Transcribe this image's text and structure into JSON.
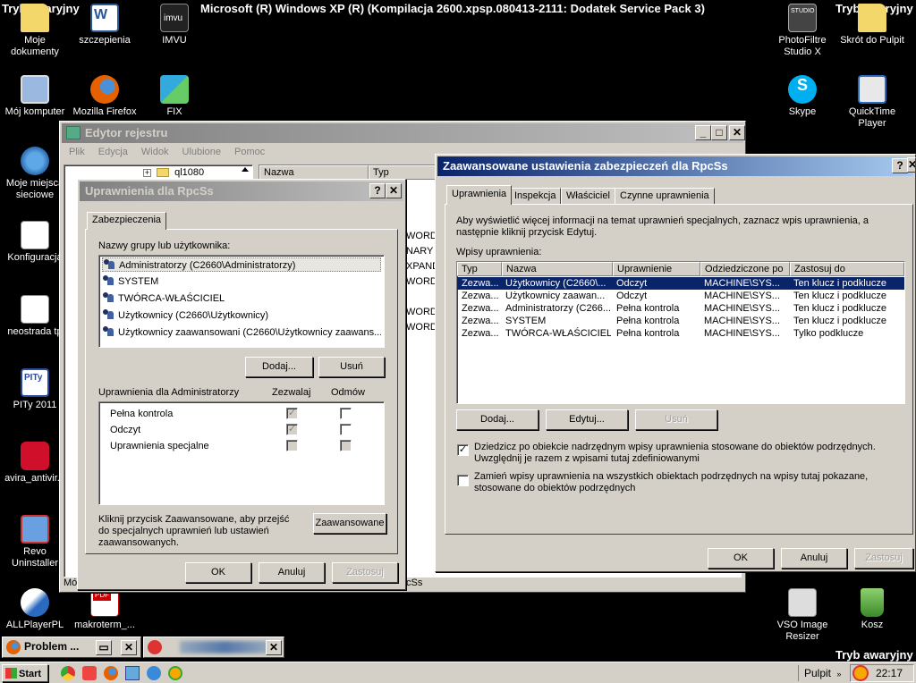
{
  "desktop": {
    "header_left": "Tryb awaryjny",
    "header_title": "Microsoft (R) Windows XP (R) (Kompilacja 2600.xpsp.080413-2111: Dodatek Service Pack 3)",
    "header_right": "Tryb awaryjny",
    "footer_right": "Tryb awaryjny",
    "icons": {
      "moje_dokumenty": "Moje dokumenty",
      "szczepienia": "szczepienia",
      "imvu": "IMVU",
      "moj_komputer": "Mój komputer",
      "firefox": "Mozilla Firefox",
      "fix": "FIX",
      "miejsca": "Moje miejsca sieciowe",
      "konfiguracja": "Konfiguracja",
      "neostrada": "neostrada tp",
      "pity": "PITy 2011",
      "avira": "avira_antivir...",
      "revo": "Revo Uninstaller",
      "allplayer": "ALLPlayerPL",
      "makroterm": "makroterm_...",
      "photofiltre": "PhotoFiltre Studio X",
      "skrot": "Skrót do Pulpit",
      "skype": "Skype",
      "quicktime": "QuickTime Player",
      "vso": "VSO Image Resizer",
      "kosz": "Kosz"
    }
  },
  "regedit": {
    "title": "Edytor rejestru",
    "menu": [
      "Plik",
      "Edycja",
      "Widok",
      "Ulubione",
      "Pomoc"
    ],
    "tree_item": "ql1080",
    "col_name": "Nazwa",
    "col_type": "Typ",
    "type_values": [
      "WORD",
      "NARY",
      "XPAND_",
      "WORD",
      "WORD",
      "WORD"
    ],
    "status_left": "Mó",
    "status_right": "ìcSs"
  },
  "perm_dialog": {
    "title": "Uprawnienia dla RpcSs",
    "help": "?",
    "close": "✕",
    "tab": "Zabezpieczenia",
    "group_label": "Nazwy grupy lub użytkownika:",
    "users": [
      "Administratorzy (C2660\\Administratorzy)",
      "SYSTEM",
      "TWÓRCA-WŁAŚCICIEL",
      "Użytkownicy (C2660\\Użytkownicy)",
      "Użytkownicy zaawansowani (C2660\\Użytkownicy zaawans..."
    ],
    "add": "Dodaj...",
    "remove": "Usuń",
    "perm_for": "Uprawnienia dla Administratorzy",
    "allow": "Zezwalaj",
    "deny": "Odmów",
    "perms": [
      {
        "name": "Pełna kontrola",
        "allow": true,
        "deny": false
      },
      {
        "name": "Odczyt",
        "allow": true,
        "deny": false
      },
      {
        "name": "Uprawnienia specjalne",
        "allow": false,
        "deny": false
      }
    ],
    "advanced_hint": "Kliknij przycisk Zaawansowane, aby przejść do specjalnych uprawnień lub ustawień zaawansowanych.",
    "advanced": "Zaawansowane",
    "ok": "OK",
    "cancel": "Anuluj",
    "apply": "Zastosuj"
  },
  "adv_dialog": {
    "title": "Zaawansowane ustawienia zabezpieczeń dla RpcSs",
    "help": "?",
    "tabs": [
      "Uprawnienia",
      "Inspekcja",
      "Właściciel",
      "Czynne uprawnienia"
    ],
    "info": "Aby wyświetlić więcej informacji na temat uprawnień specjalnych, zaznacz wpis uprawnienia, a następnie kliknij przycisk Edytuj.",
    "entries_label": "Wpisy uprawnienia:",
    "columns": [
      "Typ",
      "Nazwa",
      "Uprawnienie",
      "Odziedziczone po",
      "Zastosuj do"
    ],
    "rows": [
      [
        "Zezwa...",
        "Użytkownicy (C2660\\...",
        "Odczyt",
        "MACHINE\\SYS...",
        "Ten klucz i podklucze"
      ],
      [
        "Zezwa...",
        "Użytkownicy zaawan...",
        "Odczyt",
        "MACHINE\\SYS...",
        "Ten klucz i podklucze"
      ],
      [
        "Zezwa...",
        "Administratorzy (C266...",
        "Pełna kontrola",
        "MACHINE\\SYS...",
        "Ten klucz i podklucze"
      ],
      [
        "Zezwa...",
        "SYSTEM",
        "Pełna kontrola",
        "MACHINE\\SYS...",
        "Ten klucz i podklucze"
      ],
      [
        "Zezwa...",
        "TWÓRCA-WŁAŚCICIEL",
        "Pełna kontrola",
        "MACHINE\\SYS...",
        "Tylko podklucze"
      ]
    ],
    "add": "Dodaj...",
    "edit": "Edytuj...",
    "remove": "Usuń",
    "inherit_text": "Dziedzicz po obiekcie nadrzędnym wpisy uprawnienia stosowane do obiektów podrzędnych. Uwzględnij je razem z wpisami tutaj zdefiniowanymi",
    "inherit_checked": true,
    "replace_text": "Zamień wpisy uprawnienia na wszystkich obiektach podrzędnych na wpisy tutaj pokazane, stosowane do obiektów podrzędnych",
    "replace_checked": false,
    "ok": "OK",
    "cancel": "Anuluj",
    "apply": "Zastosuj"
  },
  "taskbar": {
    "start": "Start",
    "task1": "Problem ...",
    "pulpit": "Pulpit",
    "clock": "22:17"
  }
}
